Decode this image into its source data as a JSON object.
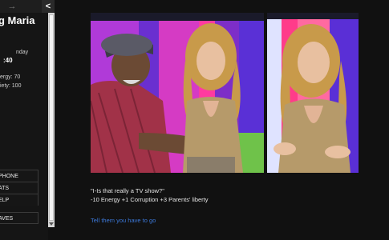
{
  "nav": {
    "forward_icon": "→",
    "back_icon": "<"
  },
  "character": {
    "name": "g Maria"
  },
  "clock": {
    "day": "nday",
    "time": ":40"
  },
  "stats": {
    "line1": "ergy: 70",
    "line2": "iety: 100"
  },
  "menu": [
    {
      "label": "PHONE"
    },
    {
      "label": "ATS"
    },
    {
      "label": "ELP"
    },
    {
      "label": "AVES"
    }
  ],
  "dialogue": {
    "quote": "\"I-Is that really a TV show?\"",
    "effects": "-10 Energy +1 Corruption +3 Parents' liberty"
  },
  "choices": [
    {
      "label": "Tell them you have to go"
    }
  ]
}
